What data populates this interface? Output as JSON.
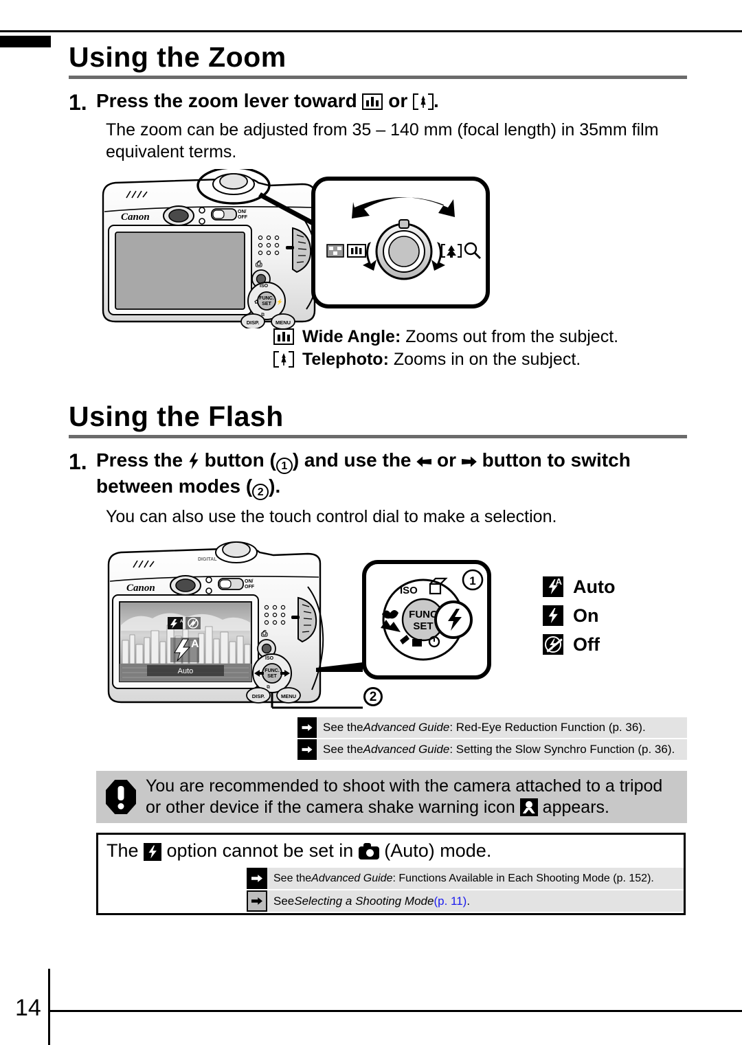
{
  "page": {
    "number": "14",
    "corner_tab": "chapter-tab"
  },
  "sections": [
    {
      "id": "zoom",
      "title": "Using the Zoom",
      "step_number": "1.",
      "step_head_parts": {
        "a": "Press the zoom lever toward ",
        "icon1": "wide-angle-icon",
        "b": " or ",
        "icon2": "telephoto-icon",
        "c": "."
      },
      "step_text": "The zoom can be adjusted from 35 – 140 mm (focal length) in 35mm film equivalent terms.",
      "legend": [
        {
          "icon": "wide-angle-icon",
          "term": "Wide Angle:",
          "desc": " Zooms out from the subject."
        },
        {
          "icon": "telephoto-icon",
          "term": "Telephoto:",
          "desc": " Zooms in on the subject."
        }
      ]
    },
    {
      "id": "flash",
      "title": "Using the Flash",
      "step_number": "1.",
      "step_head_parts": {
        "a": "Press the ",
        "icon1": "flash-bolt-icon",
        "b": " button (",
        "num1": "1",
        "c": ") and use the ",
        "icon2": "left-arrow-icon",
        "d": " or ",
        "icon3": "right-arrow-icon",
        "e": " button to switch between modes (",
        "num2": "2",
        "f": ")."
      },
      "step_text": "You can also use the touch control dial to make a selection."
    }
  ],
  "flash_modes": [
    {
      "icon": "flash-auto-icon",
      "label": "Auto"
    },
    {
      "icon": "flash-on-icon",
      "label": "On"
    },
    {
      "icon": "flash-off-icon",
      "label": "Off"
    }
  ],
  "references_flash": [
    {
      "arrow_style": "black",
      "prefix": "See the ",
      "italic": "Advanced Guide",
      "suffix": ": Red-Eye Reduction Function (p. 36)."
    },
    {
      "arrow_style": "black",
      "prefix": "See the ",
      "italic": "Advanced Guide",
      "suffix": ": Setting the Slow Synchro Function (p. 36)."
    }
  ],
  "warning": {
    "icon": "exclamation-octagon-icon",
    "line1": "You are recommended to shoot with the camera attached to a tripod",
    "line2_a": "or other device if the camera shake warning icon ",
    "line2_icon": "camera-shake-warning-icon",
    "line2_b": " appears."
  },
  "note": {
    "line_a": "The ",
    "line_icon1": "flash-on-icon",
    "line_b": " option cannot be set in ",
    "line_icon2": "auto-mode-camera-icon",
    "line_c": " (Auto) mode.",
    "references": [
      {
        "arrow_style": "black",
        "prefix": "See the ",
        "italic": "Advanced Guide",
        "suffix": ": Functions Available in Each Shooting Mode (p. 152)."
      },
      {
        "arrow_style": "gray",
        "prefix": "See ",
        "italic": "Selecting a Shooting Mode",
        "suffix_blue": " (p. 11)",
        "suffix": "."
      }
    ]
  },
  "illustration_zoom": {
    "brand": "Canon",
    "on_off_label": "ON/OFF",
    "disp_label": "DISP.",
    "menu_label": "MENU",
    "func_label_1": "FUNC.",
    "func_label_2": "SET",
    "iso_label": "ISO",
    "callout_icons": [
      "index-icon",
      "wide-angle-icon",
      "telephoto-icon",
      "magnifier-icon"
    ]
  },
  "illustration_flash": {
    "brand": "Canon",
    "on_off_label": "ON/OFF",
    "disp_label": "DISP.",
    "menu_label": "MENU",
    "func_label_1": "FUNC.",
    "func_label_2": "SET",
    "iso_label": "ISO",
    "lcd_mode_label": "Auto",
    "marker_1": "1",
    "marker_2": "2"
  },
  "colors": {
    "rule_gray": "#6b6b6b",
    "ref_row_bg": "#e3e3e3",
    "warn_bg": "#c8c8c8",
    "link_blue": "#1a1aee"
  }
}
